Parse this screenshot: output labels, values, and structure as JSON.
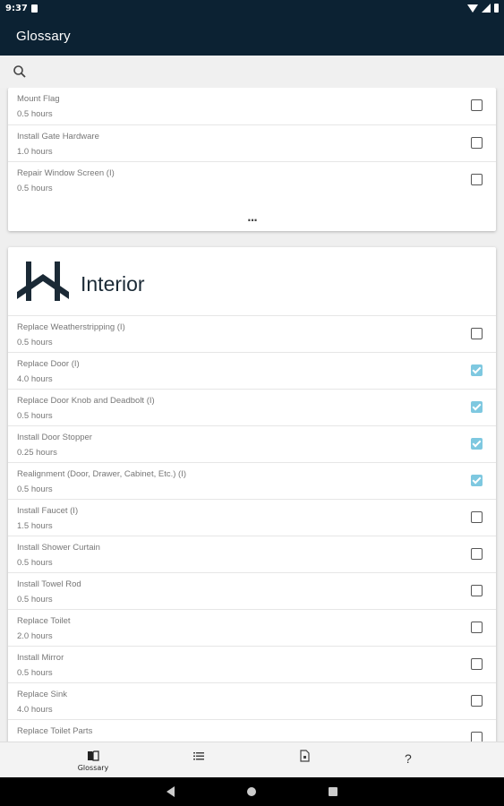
{
  "status_bar": {
    "time": "9:37"
  },
  "app_bar": {
    "title": "Glossary"
  },
  "search": {
    "icon": "search-icon"
  },
  "previous_section": {
    "items": [
      {
        "title": "Mount Flag",
        "hours": "0.5 hours",
        "checked": false
      },
      {
        "title": "Install Gate Hardware",
        "hours": "1.0 hours",
        "checked": false
      },
      {
        "title": "Repair Window Screen (I)",
        "hours": "0.5 hours",
        "checked": false
      }
    ],
    "more_label": "..."
  },
  "interior_section": {
    "title": "Interior",
    "items": [
      {
        "title": "Replace Weatherstripping (I)",
        "hours": "0.5 hours",
        "checked": false
      },
      {
        "title": "Replace Door (I)",
        "hours": "4.0 hours",
        "checked": true
      },
      {
        "title": "Replace Door Knob and Deadbolt (I)",
        "hours": "0.5 hours",
        "checked": true
      },
      {
        "title": "Install Door Stopper",
        "hours": "0.25 hours",
        "checked": true
      },
      {
        "title": "Realignment (Door, Drawer, Cabinet, Etc.) (I)",
        "hours": "0.5 hours",
        "checked": true
      },
      {
        "title": "Install Faucet (I)",
        "hours": "1.5 hours",
        "checked": false
      },
      {
        "title": "Install Shower Curtain",
        "hours": "0.5 hours",
        "checked": false
      },
      {
        "title": "Install Towel Rod",
        "hours": "0.5 hours",
        "checked": false
      },
      {
        "title": "Replace Toilet",
        "hours": "2.0 hours",
        "checked": false
      },
      {
        "title": "Install Mirror",
        "hours": "0.5 hours",
        "checked": false
      },
      {
        "title": "Replace Sink",
        "hours": "4.0 hours",
        "checked": false
      },
      {
        "title": "Replace Toilet Parts",
        "hours": "",
        "checked": false
      }
    ]
  },
  "bottom_nav": {
    "glossary_label": "Glossary",
    "question_label": "?"
  },
  "colors": {
    "app_bar": "#0c2233",
    "checked": "#7ec8e0",
    "logo": "#1b2a36"
  }
}
